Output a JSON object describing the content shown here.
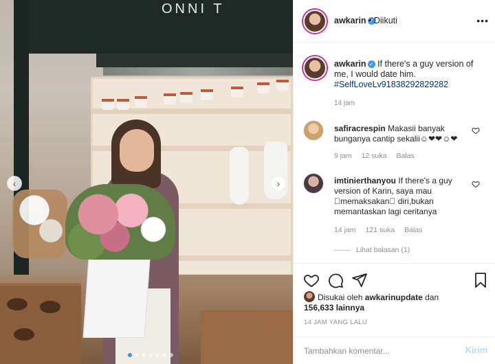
{
  "post": {
    "username": "awkarin",
    "follow_status": "Diikuti",
    "more_label": "•••",
    "caption_text": "If there's a guy version of me, I would date him.",
    "hashtag": "#SelfLoveLv91838292829282",
    "caption_time": "14 jam",
    "storefront_text": "ONNI T"
  },
  "comments": [
    {
      "username": "safiracrespin",
      "text": "Makasii banyak bunganya cantip sekalii☺❤❤☺❤",
      "time": "9 jam",
      "likes": "12 suka",
      "reply": "Balas"
    },
    {
      "username": "imtinierthanyou",
      "text": "If there's a guy version of Karin, saya mau 􏰀memaksakan􏰀 diri,bukan memantaskan lagi ceritanya",
      "time": "14 jam",
      "likes": "121 suka",
      "reply": "Balas",
      "view_replies": "Lihat balasan (1)"
    }
  ],
  "engagement": {
    "liked_by_prefix": "Disukai oleh",
    "liked_by_user": "awkarinupdate",
    "liked_by_mid": "dan",
    "likes_count": "156,633 lainnya",
    "post_date": "14 JAM YANG LALU"
  },
  "composer": {
    "placeholder": "Tambahkan komentar...",
    "post_label": "Kirim"
  },
  "carousel": {
    "prev_label": "‹",
    "next_label": "›",
    "total_slides": 7,
    "active_slide": 1
  },
  "colors": {
    "verified": "#3897f0",
    "hashtag": "#00376b",
    "muted": "#8e8e8e",
    "post_disabled": "#b2dffc",
    "story_ring": "#d6249f"
  },
  "icons": {
    "verified": "verified-badge-icon",
    "like": "heart-icon",
    "comment": "comment-icon",
    "share": "send-icon",
    "save": "bookmark-icon"
  }
}
